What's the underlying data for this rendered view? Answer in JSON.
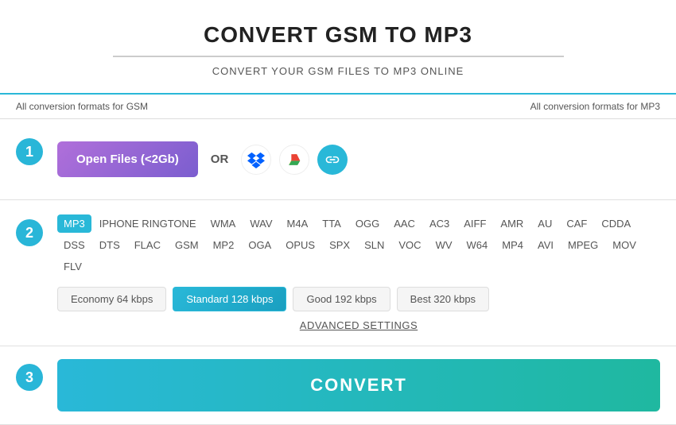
{
  "header": {
    "title": "CONVERT GSM TO MP3",
    "subtitle": "CONVERT YOUR GSM FILES TO MP3 ONLINE",
    "divider": true
  },
  "tabs": {
    "left": "All conversion formats for GSM",
    "right": "All conversion formats for MP3"
  },
  "step1": {
    "badge": "1",
    "open_files_label": "Open Files (<2Gb)",
    "or_label": "OR",
    "dropbox_label": "Dropbox",
    "gdrive_label": "Google Drive",
    "link_label": "Link"
  },
  "step2": {
    "badge": "2",
    "formats": [
      "MP3",
      "IPHONE RINGTONE",
      "WMA",
      "WAV",
      "M4A",
      "TTA",
      "OGG",
      "AAC",
      "AC3",
      "AIFF",
      "AMR",
      "AU",
      "CAF",
      "CDDA",
      "DSS",
      "DTS",
      "FLAC",
      "GSM",
      "MP2",
      "OGA",
      "OPUS",
      "SPX",
      "SLN",
      "VOC",
      "WV",
      "W64",
      "MP4",
      "AVI",
      "MPEG",
      "MOV",
      "FLV"
    ],
    "active_format": "MP3",
    "quality_options": [
      {
        "label": "Economy 64 kbps",
        "active": false
      },
      {
        "label": "Standard 128 kbps",
        "active": true
      },
      {
        "label": "Good 192 kbps",
        "active": false
      },
      {
        "label": "Best 320 kbps",
        "active": false
      }
    ],
    "advanced_label": "ADVANCED SETTINGS"
  },
  "step3": {
    "badge": "3",
    "convert_label": "CONVERT"
  }
}
